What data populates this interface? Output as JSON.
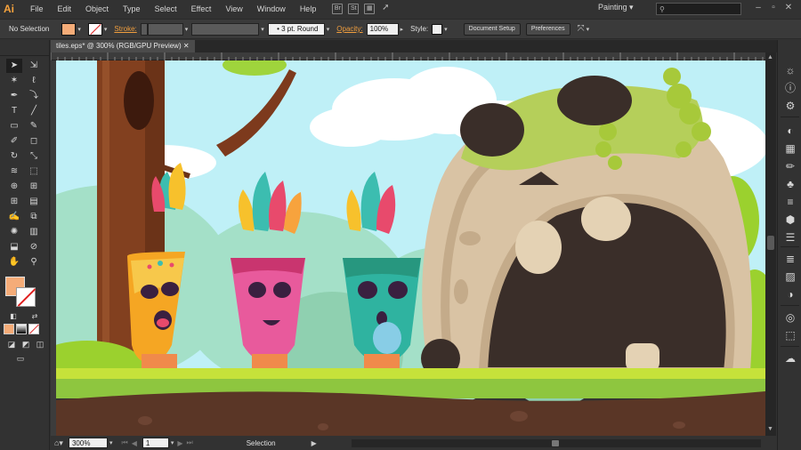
{
  "app": {
    "logo": "Ai",
    "menu": [
      "File",
      "Edit",
      "Object",
      "Type",
      "Select",
      "Effect",
      "View",
      "Window",
      "Help"
    ],
    "workspace": "Painting",
    "search_placeholder": ""
  },
  "control_bar": {
    "selection_label": "No Selection",
    "fill_color": "#f5ac78",
    "stroke_label": "Stroke:",
    "brush_label": "3 pt. Round",
    "opacity_label": "Opacity:",
    "opacity_value": "100%",
    "style_label": "Style:",
    "document_setup": "Document Setup",
    "preferences": "Preferences"
  },
  "document": {
    "tab_title": "tiles.eps* @ 300% (RGB/GPU Preview)"
  },
  "status": {
    "zoom": "300%",
    "artboard_number": "1",
    "current_tool": "Selection"
  },
  "colors": {
    "accent": "#f09e3e",
    "ui_dark": "#323232",
    "sky": "#bff0f7",
    "grass": "#b4dc2c",
    "soil": "#5a3626"
  },
  "tools": [
    "selection-tool",
    "direct-selection-tool",
    "magic-wand-tool",
    "lasso-tool",
    "pen-tool",
    "curvature-tool",
    "type-tool",
    "line-tool",
    "rectangle-tool",
    "paintbrush-tool",
    "shaper-tool",
    "eraser-tool",
    "rotate-tool",
    "scale-tool",
    "width-tool",
    "free-transform-tool",
    "shape-builder-tool",
    "perspective-grid-tool",
    "mesh-tool",
    "gradient-tool",
    "eyedropper-tool",
    "blend-tool",
    "symbol-sprayer-tool",
    "column-graph-tool",
    "artboard-tool",
    "slice-tool",
    "hand-tool",
    "zoom-tool"
  ],
  "dock_icons": [
    "sun-icon",
    "info-icon",
    "gear-icon",
    "color-icon",
    "swatches-icon",
    "brushes-icon",
    "symbols-icon",
    "align-icon",
    "graphic-styles-icon",
    "layers-icon",
    "stroke-icon",
    "gradient-icon",
    "transparency-icon",
    "appearance-icon",
    "artboards-icon",
    "libraries-icon"
  ]
}
